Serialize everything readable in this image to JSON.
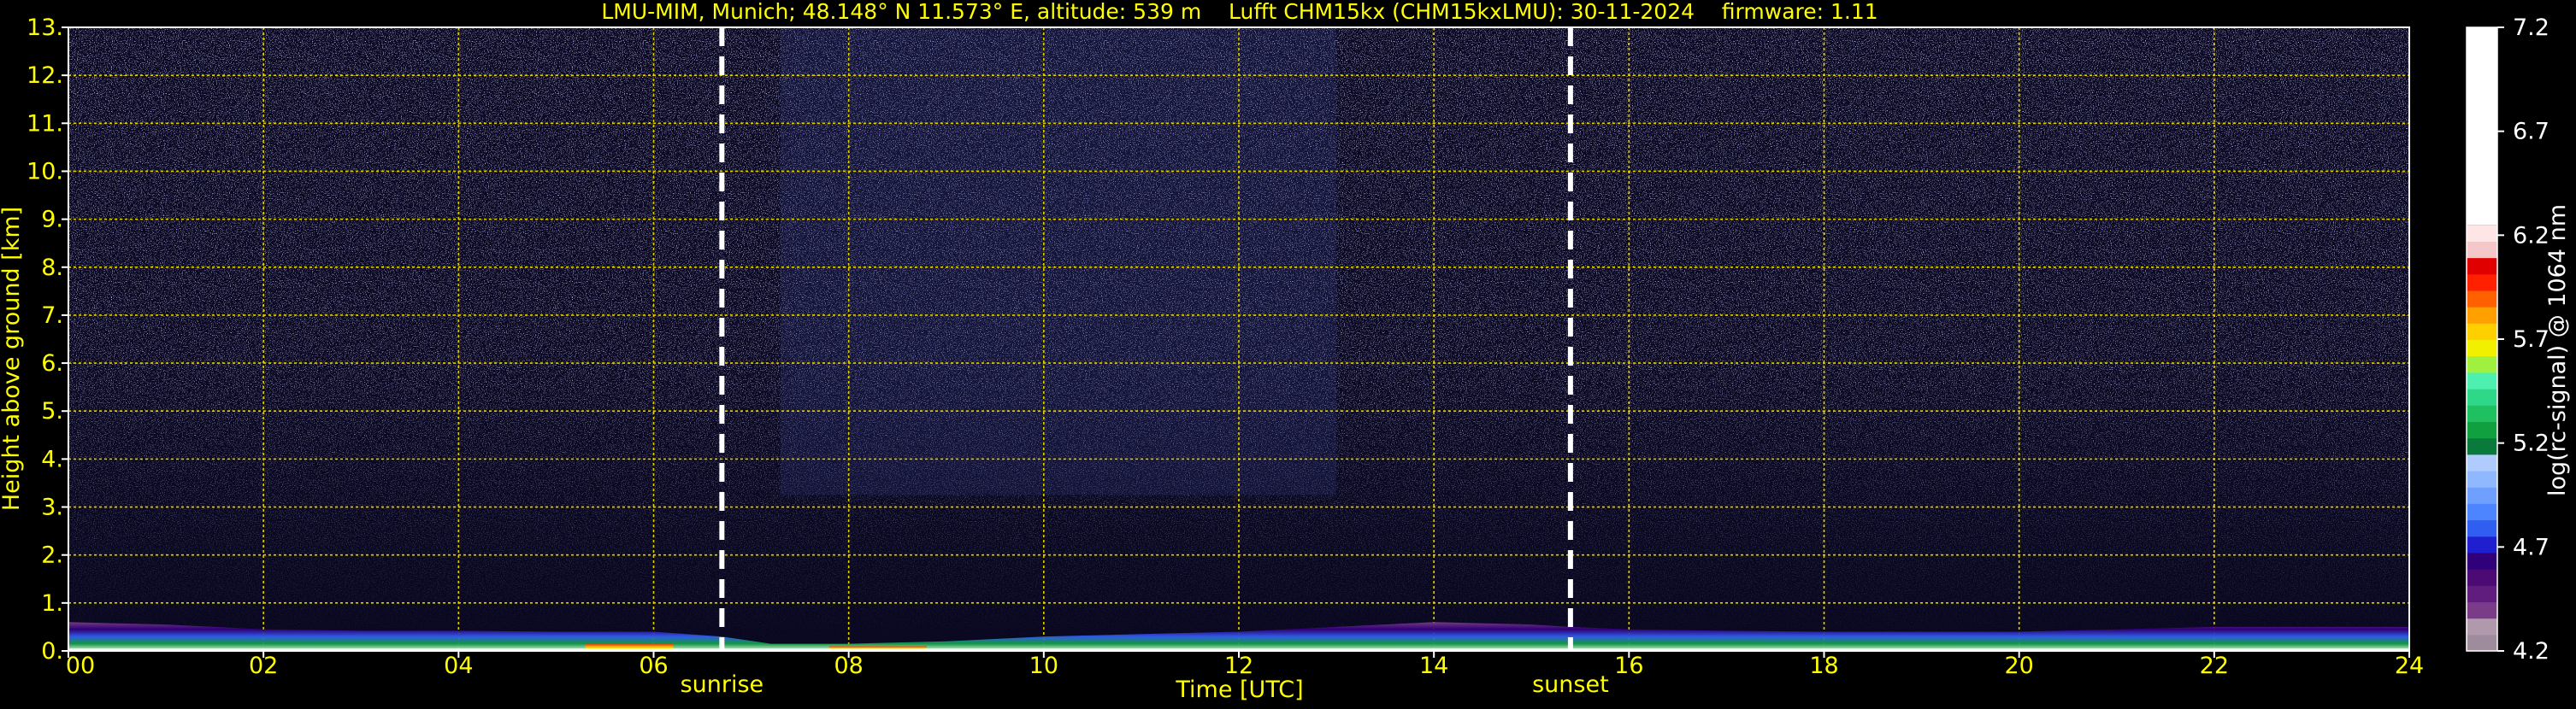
{
  "chart_data": {
    "type": "heatmap",
    "title": "LMU-MIM, Munich; 48.148° N 11.573° E, altitude: 539 m    Lufft CHM15kx (CHM15kxLMU): 30-11-2024    firmware: 1.11",
    "xlabel": "Time [UTC]",
    "ylabel": "Height above ground [km]",
    "xlim": [
      0,
      24
    ],
    "ylim": [
      0,
      13
    ],
    "x_ticks": [
      "00",
      "02",
      "04",
      "06",
      "08",
      "10",
      "12",
      "14",
      "16",
      "18",
      "20",
      "22",
      "24"
    ],
    "y_ticks": [
      "0.",
      "1.",
      "2.",
      "3.",
      "4.",
      "5.",
      "6.",
      "7.",
      "8.",
      "9.",
      "10.",
      "11.",
      "12.",
      "13."
    ],
    "grid": true,
    "markers": [
      {
        "label": "sunrise",
        "time": 6.7
      },
      {
        "label": "sunset",
        "time": 15.4
      }
    ],
    "colorbar": {
      "label": "log(rc-signal) @ 1064 nm",
      "range": [
        4.2,
        7.2
      ],
      "ticks": [
        "7.2",
        "6.7",
        "6.2",
        "5.7",
        "5.2",
        "4.7",
        "4.2"
      ],
      "colors": [
        "#9e8c9c",
        "#b199ad",
        "#7a3b89",
        "#611d7e",
        "#4b0a74",
        "#30007a",
        "#1f1fd0",
        "#2f5ef0",
        "#4d84ff",
        "#6fa0ff",
        "#8fb8ff",
        "#b0ccff",
        "#0a7a3c",
        "#11a040",
        "#1fc060",
        "#2fd889",
        "#4ef0b0",
        "#a0f040",
        "#f0f000",
        "#ffd000",
        "#ffa000",
        "#ff6000",
        "#ff2000",
        "#e00000",
        "#f4c8c8",
        "#ffe6e6",
        "#ffffff"
      ]
    },
    "boundary_layer_top_km": [
      [
        0,
        0.6
      ],
      [
        1,
        0.55
      ],
      [
        2,
        0.45
      ],
      [
        3,
        0.42
      ],
      [
        4,
        0.42
      ],
      [
        5,
        0.4
      ],
      [
        6,
        0.4
      ],
      [
        6.7,
        0.3
      ],
      [
        7.2,
        0.15
      ],
      [
        8,
        0.15
      ],
      [
        9,
        0.2
      ],
      [
        10,
        0.3
      ],
      [
        11,
        0.35
      ],
      [
        12,
        0.4
      ],
      [
        13,
        0.5
      ],
      [
        14,
        0.6
      ],
      [
        15,
        0.55
      ],
      [
        15.4,
        0.5
      ],
      [
        16,
        0.45
      ],
      [
        17,
        0.42
      ],
      [
        18,
        0.4
      ],
      [
        19,
        0.4
      ],
      [
        20,
        0.4
      ],
      [
        21,
        0.45
      ],
      [
        22,
        0.5
      ],
      [
        23,
        0.5
      ],
      [
        24,
        0.5
      ]
    ]
  }
}
